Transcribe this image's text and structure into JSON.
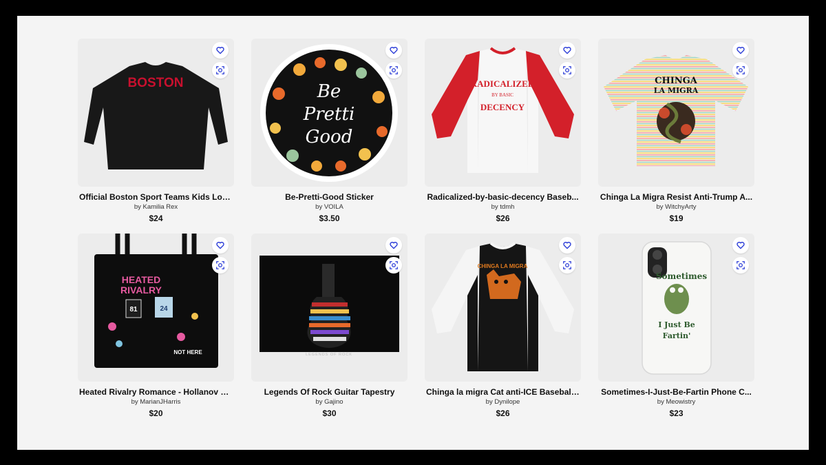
{
  "products": [
    {
      "title": "Official Boston Sport Teams Kids Lon...",
      "artist": "by Kamilia Rex",
      "price": "$24",
      "art_text": "BOSTON"
    },
    {
      "title": "Be-Pretti-Good Sticker",
      "artist": "by VOILA",
      "price": "$3.50",
      "art_text": [
        "Be",
        "Pretti",
        "Good"
      ]
    },
    {
      "title": "Radicalized-by-basic-decency Baseb...",
      "artist": "by tdmh",
      "price": "$26",
      "art_text": [
        "RADICALIZED",
        "BY BASIC",
        "DECENCY"
      ]
    },
    {
      "title": "Chinga La Migra Resist Anti-Trump A...",
      "artist": "by WitchyArty",
      "price": "$19",
      "art_text": [
        "CHINGA",
        "LA MIGRA"
      ]
    },
    {
      "title": "Heated Rivalry Romance - Hollanov C...",
      "artist": "by MarianJHarris",
      "price": "$20",
      "art_text": [
        "HEATED",
        "RIVALRY",
        "NOT HERE"
      ]
    },
    {
      "title": "Legends Of Rock Guitar Tapestry",
      "artist": "by Gajino",
      "price": "$30",
      "art_text": "LEGENDS OF ROCK"
    },
    {
      "title": "Chinga la migra Cat anti-ICE Baseball...",
      "artist": "by Dynilope",
      "price": "$26",
      "art_text": "CHINGA LA MIGRA"
    },
    {
      "title": "Sometimes-I-Just-Be-Fartin Phone C...",
      "artist": "by Meowistry",
      "price": "$23",
      "art_text": [
        "Sometimes",
        "I Just Be",
        "Fartin'"
      ]
    }
  ],
  "icons": {
    "favorite": "heart-icon",
    "visual_search": "camera-scan-icon"
  },
  "colors": {
    "accent": "#2e3fd8",
    "card_bg": "#ececec",
    "page_bg": "#f4f4f4"
  }
}
